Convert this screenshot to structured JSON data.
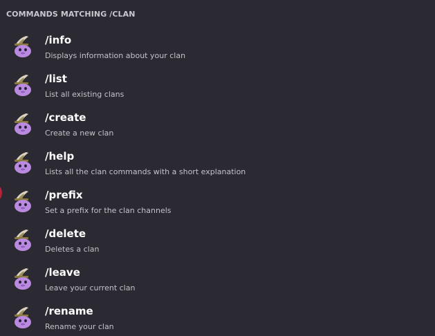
{
  "header": {
    "title": "COMMANDS MATCHING /CLAN"
  },
  "commands": [
    {
      "name": "/info",
      "description": "Displays information about your clan"
    },
    {
      "name": "/list",
      "description": "List all existing clans"
    },
    {
      "name": "/create",
      "description": "Create a new clan"
    },
    {
      "name": "/help",
      "description": "Lists all the clan commands with a short explanation"
    },
    {
      "name": "/prefix",
      "description": "Set a prefix for the clan channels"
    },
    {
      "name": "/delete",
      "description": "Deletes a clan"
    },
    {
      "name": "/leave",
      "description": "Leave your current clan"
    },
    {
      "name": "/rename",
      "description": "Rename your clan"
    }
  ],
  "icons": {
    "command_avatar": "bot-avatar-icon"
  },
  "colors": {
    "background": "#2b2931",
    "header_text": "#c9c7cf",
    "command_name": "#ffffff",
    "command_description": "#c4c2ca",
    "avatar_body": "#b98be0"
  }
}
